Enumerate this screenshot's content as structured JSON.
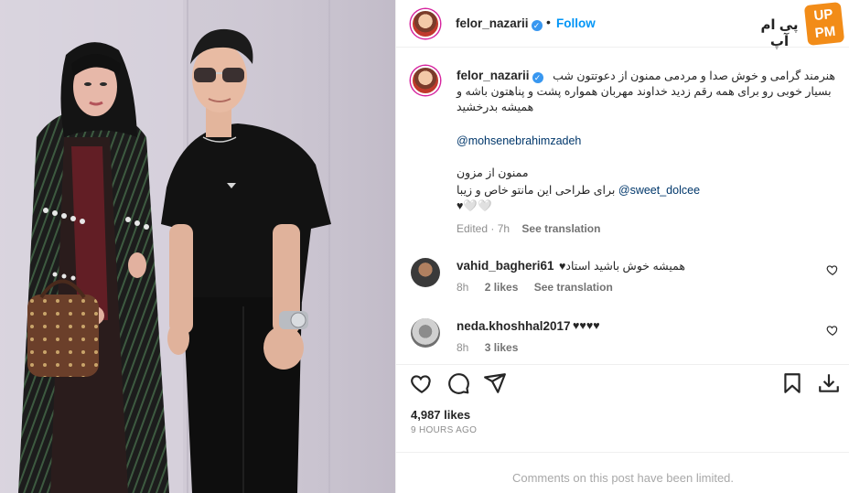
{
  "post": {
    "username": "felor_nazarii",
    "follow_label": "Follow",
    "dot": "•",
    "verified_mark": "✓"
  },
  "logo": {
    "text": "پی ام آپ",
    "badge_top": "UP",
    "badge_bottom": "PM"
  },
  "caption": {
    "username": "felor_nazarii",
    "line1": "هنرمند گرامی و خوش صدا و مردمی ممنون از دعوتتون شب",
    "line2": "بسیار خوبی رو برای همه رقم زدید خداوند مهربان همواره پشت و پناهتون باشه و",
    "line3": "همیشه بدرخشید",
    "mention1": "@mohsenebrahimzadeh",
    "line4": "ممنون از مزون",
    "mention2": "@sweet_dolcee",
    "line5": "برای طراحی این مانتو خاص و زیبا",
    "line6": "♥🤍🤍",
    "edited": "Edited",
    "time": "7h",
    "see_translation": "See translation"
  },
  "comments": [
    {
      "username": "vahid_bagheri61",
      "text": "همیشه خوش باشید استاد♥",
      "time": "8h",
      "likes": "2 likes",
      "see_translation": "See translation"
    },
    {
      "username": "neda.khoshhal2017",
      "text": "♥♥♥♥",
      "time": "8h",
      "likes": "3 likes"
    }
  ],
  "actions": {
    "like_icon": "heart-icon",
    "comment_icon": "comment-icon",
    "share_icon": "send-icon",
    "save_icon": "bookmark-icon",
    "download_icon": "download-icon"
  },
  "stats": {
    "likes": "4,987 likes",
    "ago": "9 HOURS AGO"
  },
  "footer": {
    "limited": "Comments on this post have been limited."
  },
  "colors": {
    "accent": "#0095f6",
    "verified": "#3897f0",
    "muted": "#8e8e8e",
    "mention": "#00376b"
  }
}
